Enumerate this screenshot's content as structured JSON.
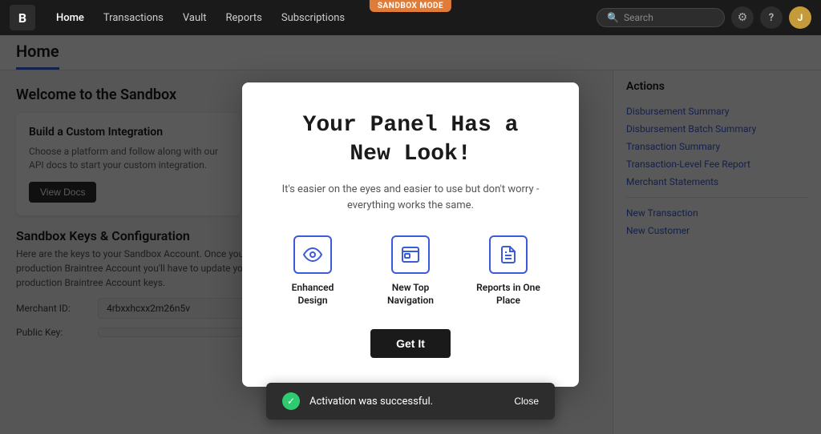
{
  "nav": {
    "logo": "B",
    "links": [
      "Home",
      "Transactions",
      "Vault",
      "Reports",
      "Subscriptions"
    ],
    "active_link": "Home",
    "sandbox_badge": "SANDBOX MODE",
    "search_placeholder": "Search",
    "avatar_initial": "J"
  },
  "page": {
    "title": "Home",
    "welcome": "Welcome to the Sandbox",
    "card": {
      "title": "Build a Custom Integration",
      "text": "Choose a platform and follow along with our API docs to start your custom integration.",
      "btn_label": "View Docs"
    }
  },
  "sidebar": {
    "section_title": "Actions",
    "links": [
      "Disbursement Summary",
      "Disbursement Batch Summary",
      "Transaction Summary",
      "Transaction-Level Fee Report",
      "Merchant Statements",
      "New Transaction",
      "New Customer"
    ]
  },
  "bottom": {
    "title": "Sandbox Keys & Configuration",
    "text": "Here are the keys to your Sandbox Account. Once you're ready to start taking payments with a production Braintree Account you'll have to update your code, replacing these with your production Braintree Account keys.",
    "merchant_id_label": "Merchant ID:",
    "merchant_id_value": "4rbxxhcxx2m26n5v",
    "public_key_label": "Public Key:"
  },
  "modal": {
    "title": "Your Panel Has a\nNew Look!",
    "subtitle": "It's easier on the eyes and easier to use but don't worry -\neverything works the same.",
    "features": [
      {
        "icon": "👁",
        "label": "Enhanced Design"
      },
      {
        "icon": "🖥",
        "label": "New Top Navigation"
      },
      {
        "icon": "📄",
        "label": "Reports in One Place"
      }
    ],
    "btn_label": "Get It"
  },
  "toast": {
    "message": "Activation was successful.",
    "close_label": "Close"
  },
  "icons": {
    "search": "🔍",
    "gear": "⚙",
    "help": "?",
    "check": "✓"
  }
}
